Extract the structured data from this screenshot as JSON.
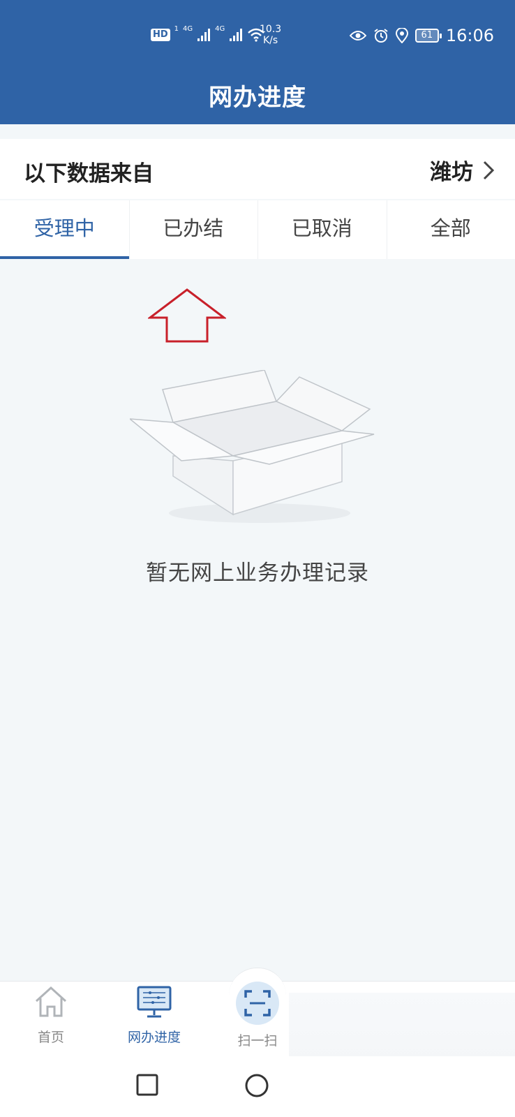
{
  "status_bar": {
    "hd": "HD",
    "sim": "1",
    "signal1": "4G",
    "signal2": "4G",
    "net_speed_value": "10.3",
    "net_speed_unit": "K/s",
    "battery": "61",
    "time": "16:06"
  },
  "header": {
    "title": "网办进度"
  },
  "source": {
    "label": "以下数据来自",
    "city": "潍坊"
  },
  "tabs": [
    {
      "label": "受理中",
      "active": true
    },
    {
      "label": "已办结",
      "active": false
    },
    {
      "label": "已取消",
      "active": false
    },
    {
      "label": "全部",
      "active": false
    }
  ],
  "empty": {
    "message": "暂无网上业务办理记录"
  },
  "bottom_nav": [
    {
      "label": "首页",
      "icon": "home-icon"
    },
    {
      "label": "网办进度",
      "icon": "monitor-icon",
      "active": true
    },
    {
      "label": "扫一扫",
      "icon": "scan-icon"
    }
  ],
  "colors": {
    "primary": "#2f63a6",
    "background": "#f3f7f9",
    "annotation_arrow": "#c8202a"
  }
}
